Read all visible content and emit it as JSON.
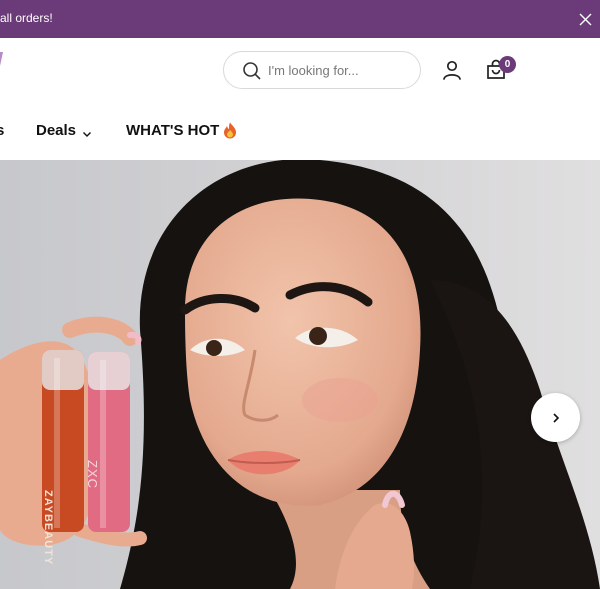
{
  "announcement": {
    "text": "all orders!",
    "close_icon": "close-icon"
  },
  "header": {
    "search": {
      "placeholder": "I'm looking for...",
      "value": ""
    },
    "cart": {
      "count": "0"
    }
  },
  "nav": {
    "items": [
      {
        "label": "s"
      },
      {
        "label": "Deals"
      },
      {
        "label": "WHAT'S HOT"
      }
    ]
  },
  "hero": {
    "product_labels": [
      "ZAYBEAUTY",
      "ZXC"
    ]
  },
  "colors": {
    "brand": "#6b3a78",
    "badge": "#6b3a78"
  }
}
